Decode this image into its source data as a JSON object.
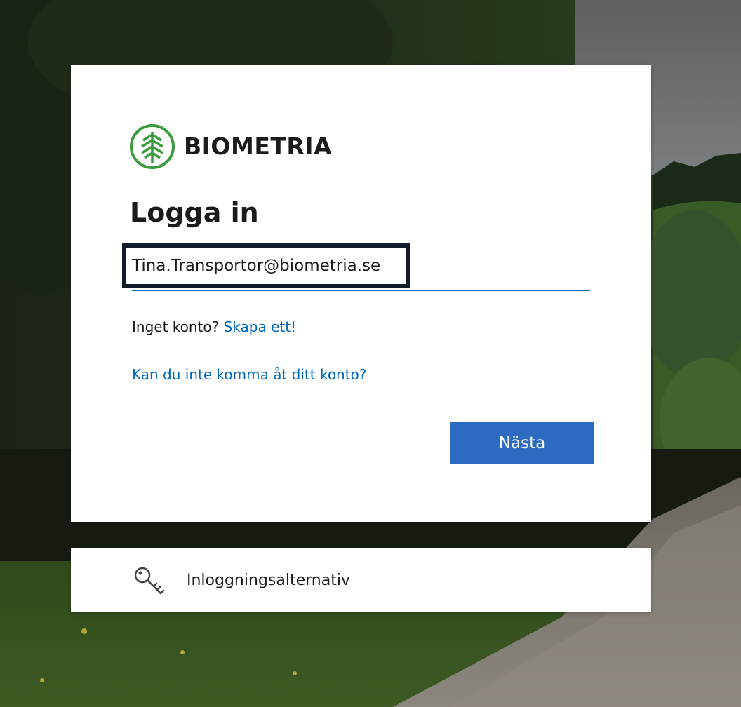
{
  "brand": {
    "name": "BIOMETRIA",
    "logo_icon": "tree-logo-icon",
    "color": "#3c9a3f"
  },
  "login": {
    "title": "Logga in",
    "email_value": "Tina.Transportor@biometria.se",
    "no_account_text": "Inget konto? ",
    "create_link": "Skapa ett!",
    "cant_access_link": "Kan du inte komma åt ditt konto?",
    "next_label": "Nästa"
  },
  "sign_in_options": {
    "icon": "key-icon",
    "label": "Inloggningsalternativ"
  },
  "colors": {
    "accent": "#0067b8",
    "button": "#2b6cc0",
    "field_border": "#0f1d2d"
  }
}
